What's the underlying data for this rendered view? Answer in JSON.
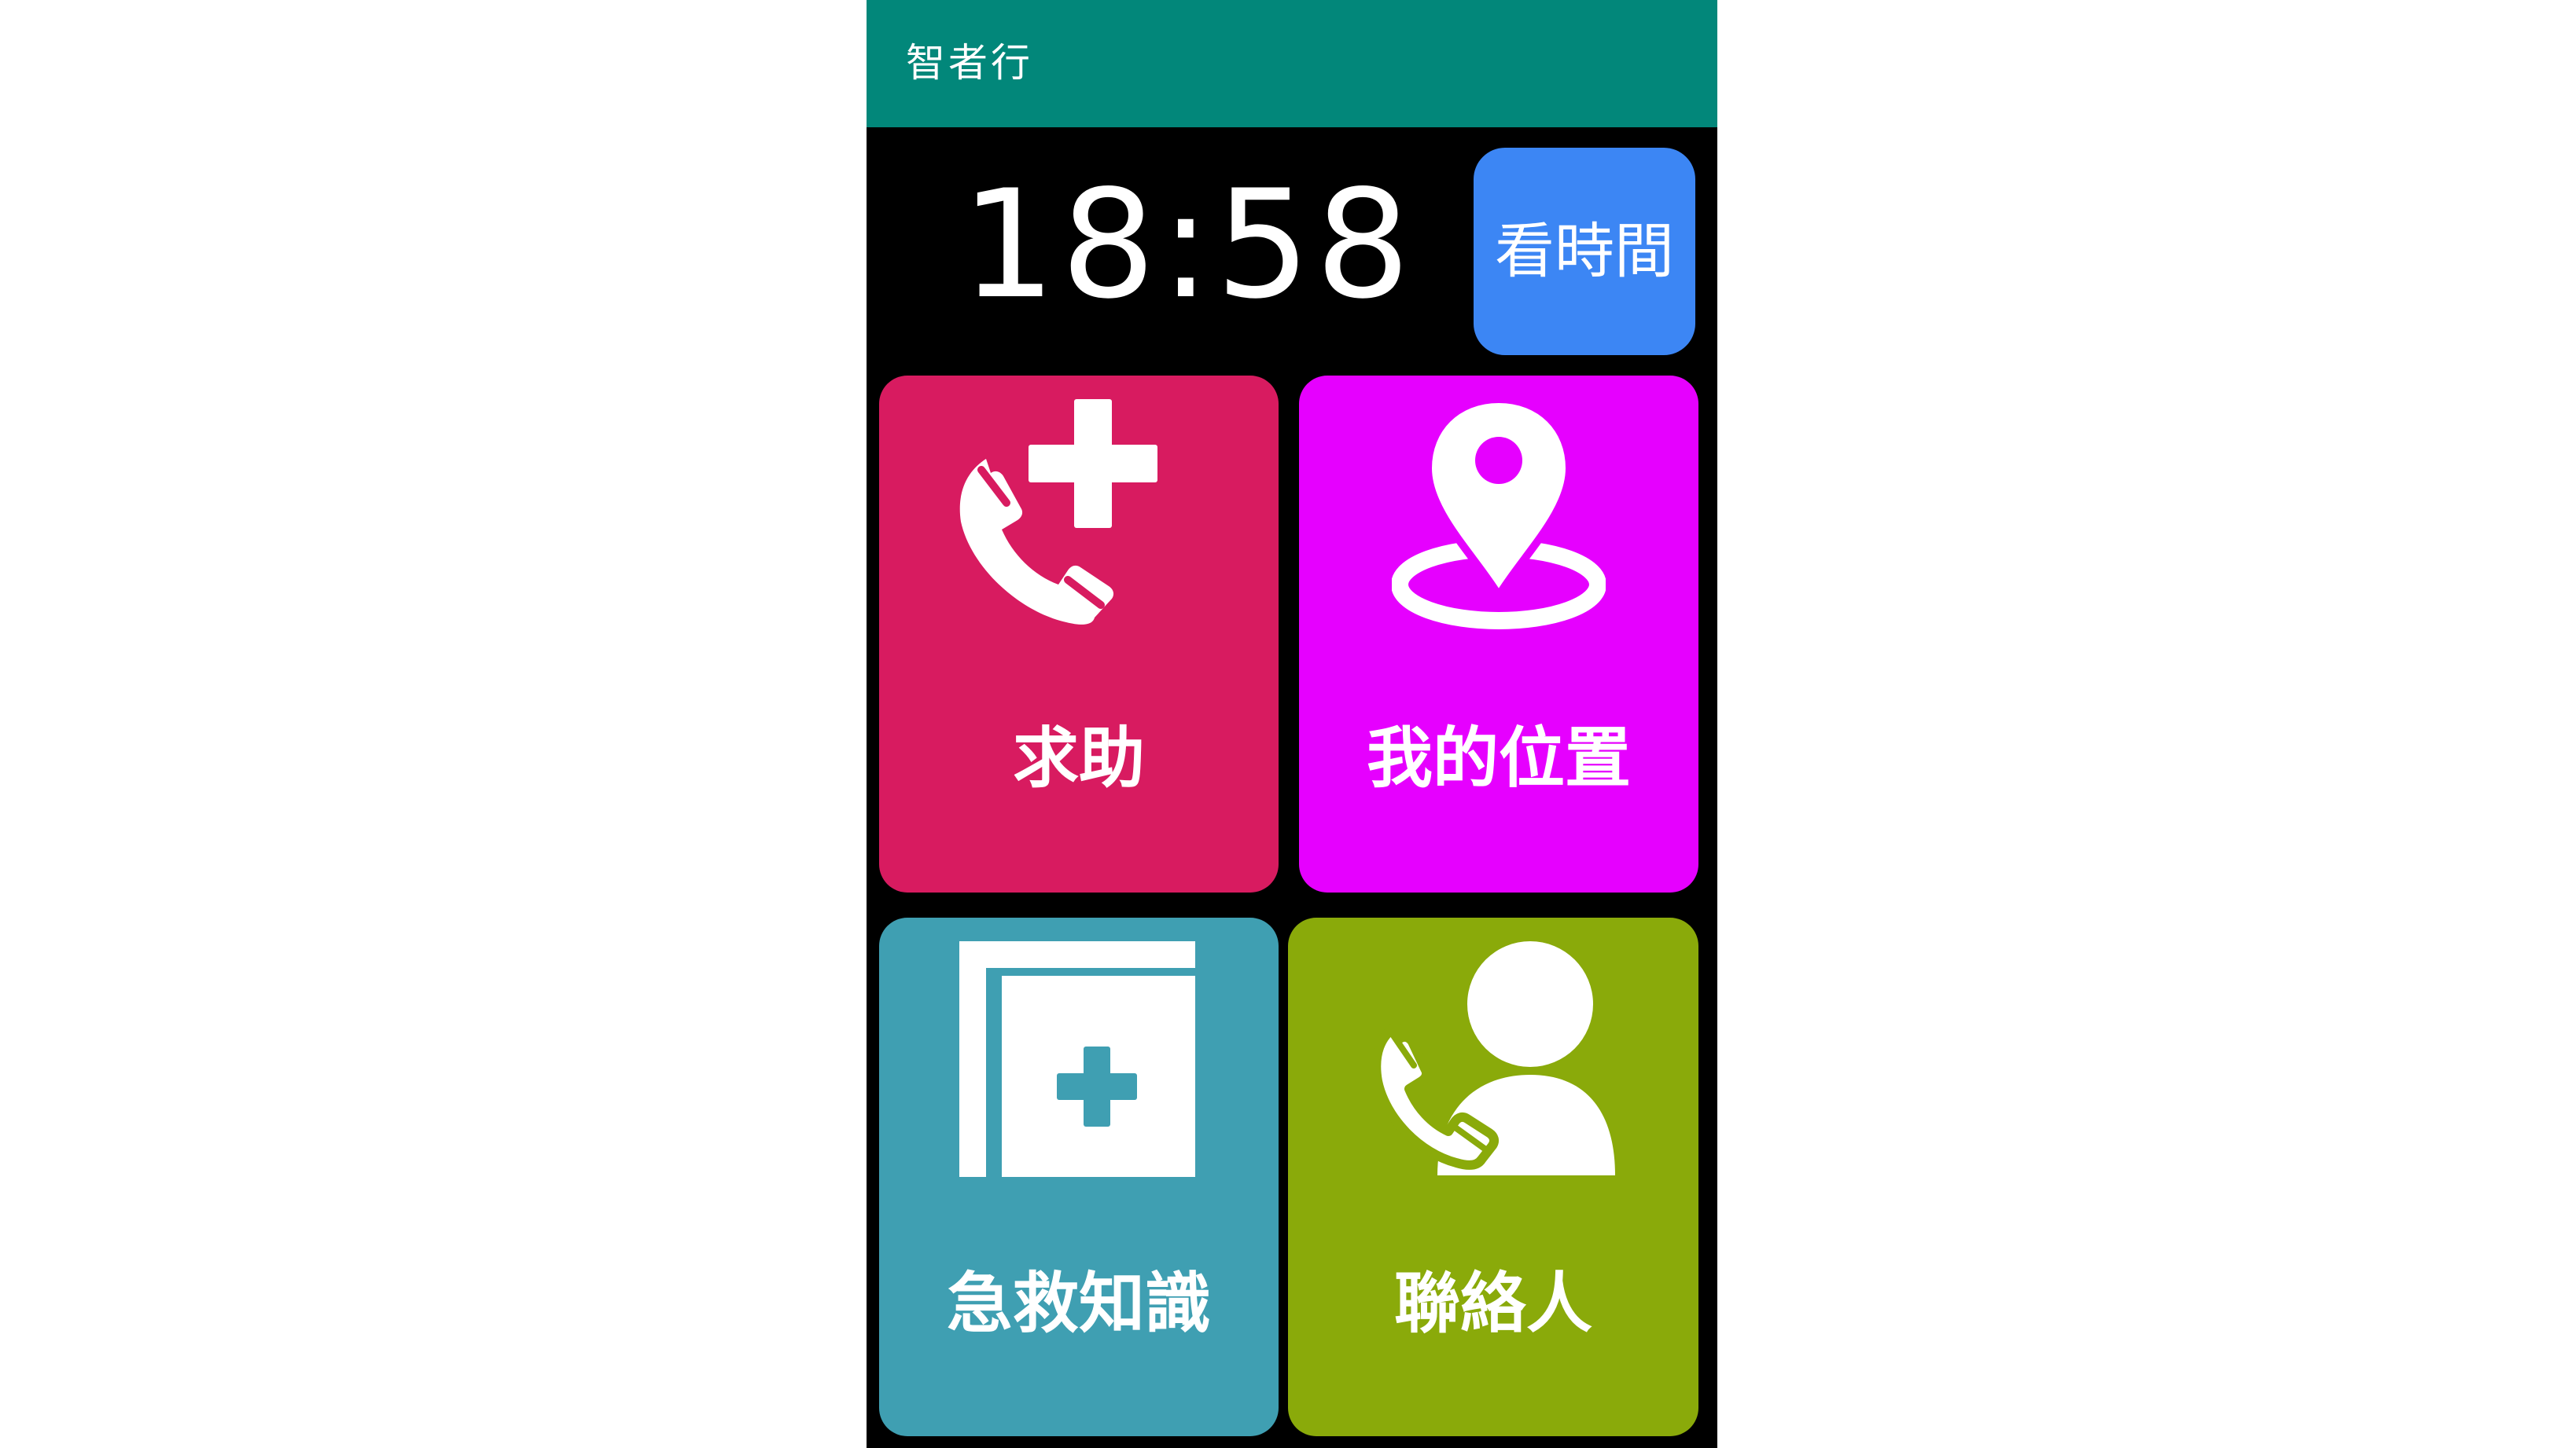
{
  "app": {
    "title": "智者行"
  },
  "clock": {
    "time": "18:58"
  },
  "time_button": {
    "label": "看時間"
  },
  "tiles": [
    {
      "label": "求助",
      "icon": "emergency-call-icon",
      "color": "#d81b60"
    },
    {
      "label": "我的位置",
      "icon": "location-pin-icon",
      "color": "#e600ff"
    },
    {
      "label": "急救知識",
      "icon": "first-aid-book-icon",
      "color": "#3f9fb2"
    },
    {
      "label": "聯絡人",
      "icon": "contact-call-icon",
      "color": "#8aaa0a"
    }
  ],
  "colors": {
    "app_bar": "#02877a",
    "background": "#000000",
    "time_button": "#3c86f4",
    "icon": "#ffffff"
  }
}
